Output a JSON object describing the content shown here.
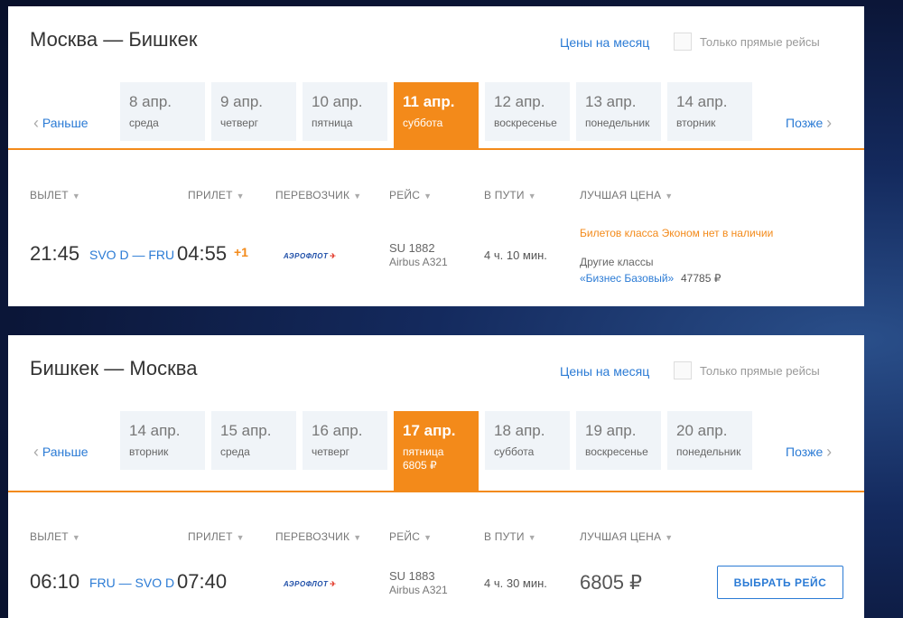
{
  "segments": [
    {
      "title": "Москва — Бишкек",
      "month_prices_link": "Цены на месяц",
      "direct_only_label": "Только прямые рейсы",
      "nav_earlier": "Раньше",
      "nav_later": "Позже",
      "dates": [
        {
          "date": "8 апр.",
          "weekday": "среда"
        },
        {
          "date": "9 апр.",
          "weekday": "четверг"
        },
        {
          "date": "10 апр.",
          "weekday": "пятница"
        },
        {
          "date": "11 апр.",
          "weekday": "суббота",
          "selected": true
        },
        {
          "date": "12 апр.",
          "weekday": "воскресенье"
        },
        {
          "date": "13 апр.",
          "weekday": "понедельник"
        },
        {
          "date": "14 апр.",
          "weekday": "вторник"
        }
      ],
      "columns": [
        "ВЫЛЕТ",
        "ПРИЛЕТ",
        "ПЕРЕВОЗЧИК",
        "РЕЙС",
        "В ПУТИ",
        "ЛУЧШАЯ ЦЕНА"
      ],
      "flight": {
        "depart_time": "21:45",
        "airports": "SVO D — FRU",
        "arrive_time": "04:55",
        "day_offset": "+1",
        "airline": "АЭРОФЛОТ",
        "flight_no": "SU 1882",
        "aircraft": "Airbus A321",
        "duration": "4 ч. 10 мин.",
        "no_economy": "Билетов класса Эконом нет в наличии",
        "other_classes": "Другие классы",
        "business_class": "«Бизнес Базовый»",
        "business_price": "47785 ₽"
      }
    },
    {
      "title": "Бишкек — Москва",
      "month_prices_link": "Цены на месяц",
      "direct_only_label": "Только прямые рейсы",
      "nav_earlier": "Раньше",
      "nav_later": "Позже",
      "dates": [
        {
          "date": "14 апр.",
          "weekday": "вторник"
        },
        {
          "date": "15 апр.",
          "weekday": "среда"
        },
        {
          "date": "16 апр.",
          "weekday": "четверг"
        },
        {
          "date": "17 апр.",
          "weekday": "пятница",
          "price": "6805 ₽",
          "selected": true
        },
        {
          "date": "18 апр.",
          "weekday": "суббота"
        },
        {
          "date": "19 апр.",
          "weekday": "воскресенье"
        },
        {
          "date": "20 апр.",
          "weekday": "понедельник"
        }
      ],
      "columns": [
        "ВЫЛЕТ",
        "ПРИЛЕТ",
        "ПЕРЕВОЗЧИК",
        "РЕЙС",
        "В ПУТИ",
        "ЛУЧШАЯ ЦЕНА"
      ],
      "flight": {
        "depart_time": "06:10",
        "airports": "FRU — SVO D",
        "arrive_time": "07:40",
        "airline": "АЭРОФЛОТ",
        "flight_no": "SU 1883",
        "aircraft": "Airbus A321",
        "duration": "4 ч. 30 мин.",
        "best_price": "6805 ₽",
        "select_button": "ВЫБРАТЬ РЕЙС"
      }
    }
  ],
  "colors": {
    "accent": "#f38a1a",
    "link": "#2b7bd5"
  }
}
